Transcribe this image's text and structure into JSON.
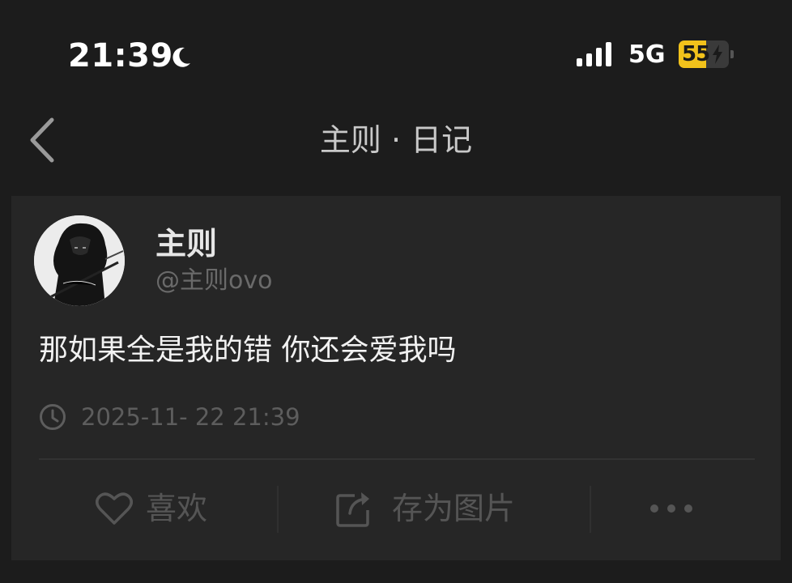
{
  "status_bar": {
    "time": "21:39",
    "network": "5G",
    "battery_level": "55",
    "battery_fraction": 0.55,
    "icons": [
      "moon-icon",
      "signal-icon",
      "charging-bolt-icon"
    ]
  },
  "nav": {
    "title": "主则 · 日记",
    "back_icon": "chevron-left-icon"
  },
  "post": {
    "author_name": "主则",
    "author_handle": "@主则ovo",
    "content": "那如果全是我的错 你还会爱我吗",
    "timestamp": "2025-11- 22 21:39"
  },
  "actions": {
    "like_label": "喜欢",
    "save_image_label": "存为图片",
    "more_icon": "more-dots-icon"
  },
  "colors": {
    "background": "#1c1c1c",
    "card": "#262626",
    "battery_accent": "#f2c21b",
    "muted_text": "#555555"
  }
}
